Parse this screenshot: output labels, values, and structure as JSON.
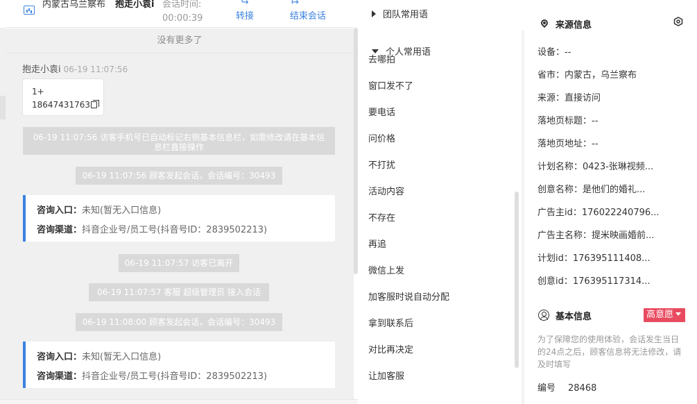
{
  "header": {
    "location": "内蒙古乌兰察布",
    "visitor_name": "抱走小袁i",
    "duration_label": "会话时间:",
    "duration_value": "00:00:39",
    "transfer_icon": "↪",
    "transfer_label": "转接",
    "end_icon": "↦",
    "end_label": "结束会话"
  },
  "chat": {
    "no_more": "没有更多了",
    "sender": "抱走小袁i",
    "sender_time": "06-19 11:07:56",
    "bubble_line1": "1+",
    "bubble_line2": "18647431763",
    "sys1": "06-19 11:07:56 访客手机号已自动标记右侧基本信息栏，如需修改请在基本信息栏直接操作",
    "sys2": "06-19 11:07:56 顾客发起会话，会话编号：30493",
    "card1_entry_label": "咨询入口：",
    "card1_entry_value": "未知(暂无入口信息)",
    "card1_channel_label": "咨询渠道：",
    "card1_channel_value": "抖音企业号/员工号(抖音号ID：2839502213)",
    "sys3": "06-19 11:07:57 访客已离开",
    "sys4": "06-19 11:07:57 客服 超级管理员 接入会话",
    "sys5": "06-19 11:08:00 顾客发起会话，会话编号：30493",
    "card2_entry_label": "咨询入口：",
    "card2_entry_value": "未知(暂无入口信息)",
    "card2_channel_label": "咨询渠道：",
    "card2_channel_value": "抖音企业号/员工号(抖音号ID：2839502213)"
  },
  "phrases": {
    "team_group": "团队常用语",
    "personal_group": "个人常用语",
    "items": [
      "去哪拍",
      "窗口发不了",
      "要电话",
      "问价格",
      "不打扰",
      "活动内容",
      "不存在",
      "再追",
      "微信上发",
      "加客服时说自动分配",
      "拿到联系后",
      "对比再决定",
      "让加客服"
    ]
  },
  "source": {
    "title": "来源信息",
    "rows": [
      {
        "label": "设备：",
        "value": "--"
      },
      {
        "label": "省市：",
        "value": "内蒙古，乌兰察布"
      },
      {
        "label": "来源：",
        "value": "直接访问"
      },
      {
        "label": "落地页标题：",
        "value": "--"
      },
      {
        "label": "落地页地址：",
        "value": "--"
      },
      {
        "label": "计划名称：",
        "value": "0423-张琳视频..."
      },
      {
        "label": "创意名称：",
        "value": "是他们的婚礼..."
      },
      {
        "label": "广告主id：",
        "value": "176022240796..."
      },
      {
        "label": "广告主名称：",
        "value": "提米映画婚前..."
      },
      {
        "label": "计划id：",
        "value": "176395111408..."
      },
      {
        "label": "创意id：",
        "value": "176395117314..."
      }
    ]
  },
  "basic": {
    "title": "基本信息",
    "intent_badge": "高意愿",
    "note": "为了保障您的使用体验，会话发生当日的24点之后，顾客信息将无法修改，请及时填写",
    "serial_label": "编号",
    "serial_value": "28468"
  },
  "colors": {
    "accent": "#3b82e0",
    "badge": "#e84a5f",
    "system_message": "#d9d9d9"
  }
}
